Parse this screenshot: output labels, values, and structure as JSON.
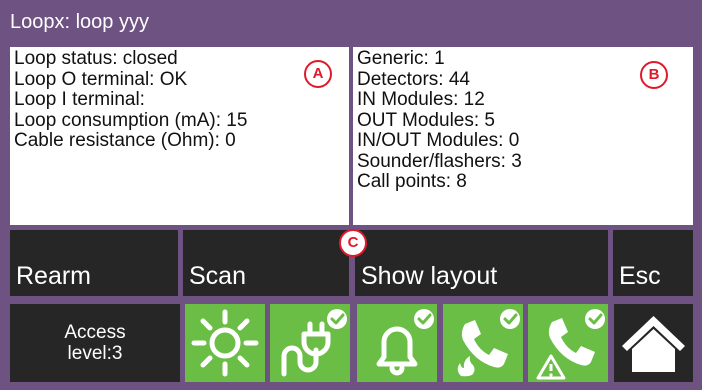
{
  "window": {
    "title": "Loopx: loop yyy"
  },
  "loop_status_panel": {
    "marker": "A",
    "lines": [
      "Loop status: closed",
      "Loop O terminal: OK",
      "Loop I terminal:",
      "Loop consumption (mA): 15",
      "Cable resistance (Ohm): 0"
    ]
  },
  "device_counts_panel": {
    "marker": "B",
    "lines": [
      "Generic: 1",
      "Detectors: 44",
      "IN Modules: 12",
      "OUT Modules: 5",
      "IN/OUT Modules: 0",
      "Sounder/flashers: 3",
      "Call points: 8"
    ]
  },
  "actions": {
    "marker": "C",
    "rearm": "Rearm",
    "scan": "Scan",
    "show_layout": "Show layout",
    "esc": "Esc"
  },
  "status_bar": {
    "access_line1": "Access",
    "access_line2": "level:3",
    "tiles": [
      {
        "icon": "sun-icon",
        "checked": false
      },
      {
        "icon": "power-plug-icon",
        "checked": true
      },
      {
        "icon": "bell-icon",
        "checked": true
      },
      {
        "icon": "fire-call-icon",
        "checked": true
      },
      {
        "icon": "warning-call-icon",
        "checked": true
      }
    ],
    "home_icon": "home-icon"
  },
  "colors": {
    "frame": "#6d5282",
    "tile_green": "#6abd45",
    "button_dark": "#262626",
    "marker_red": "#e0192b"
  }
}
